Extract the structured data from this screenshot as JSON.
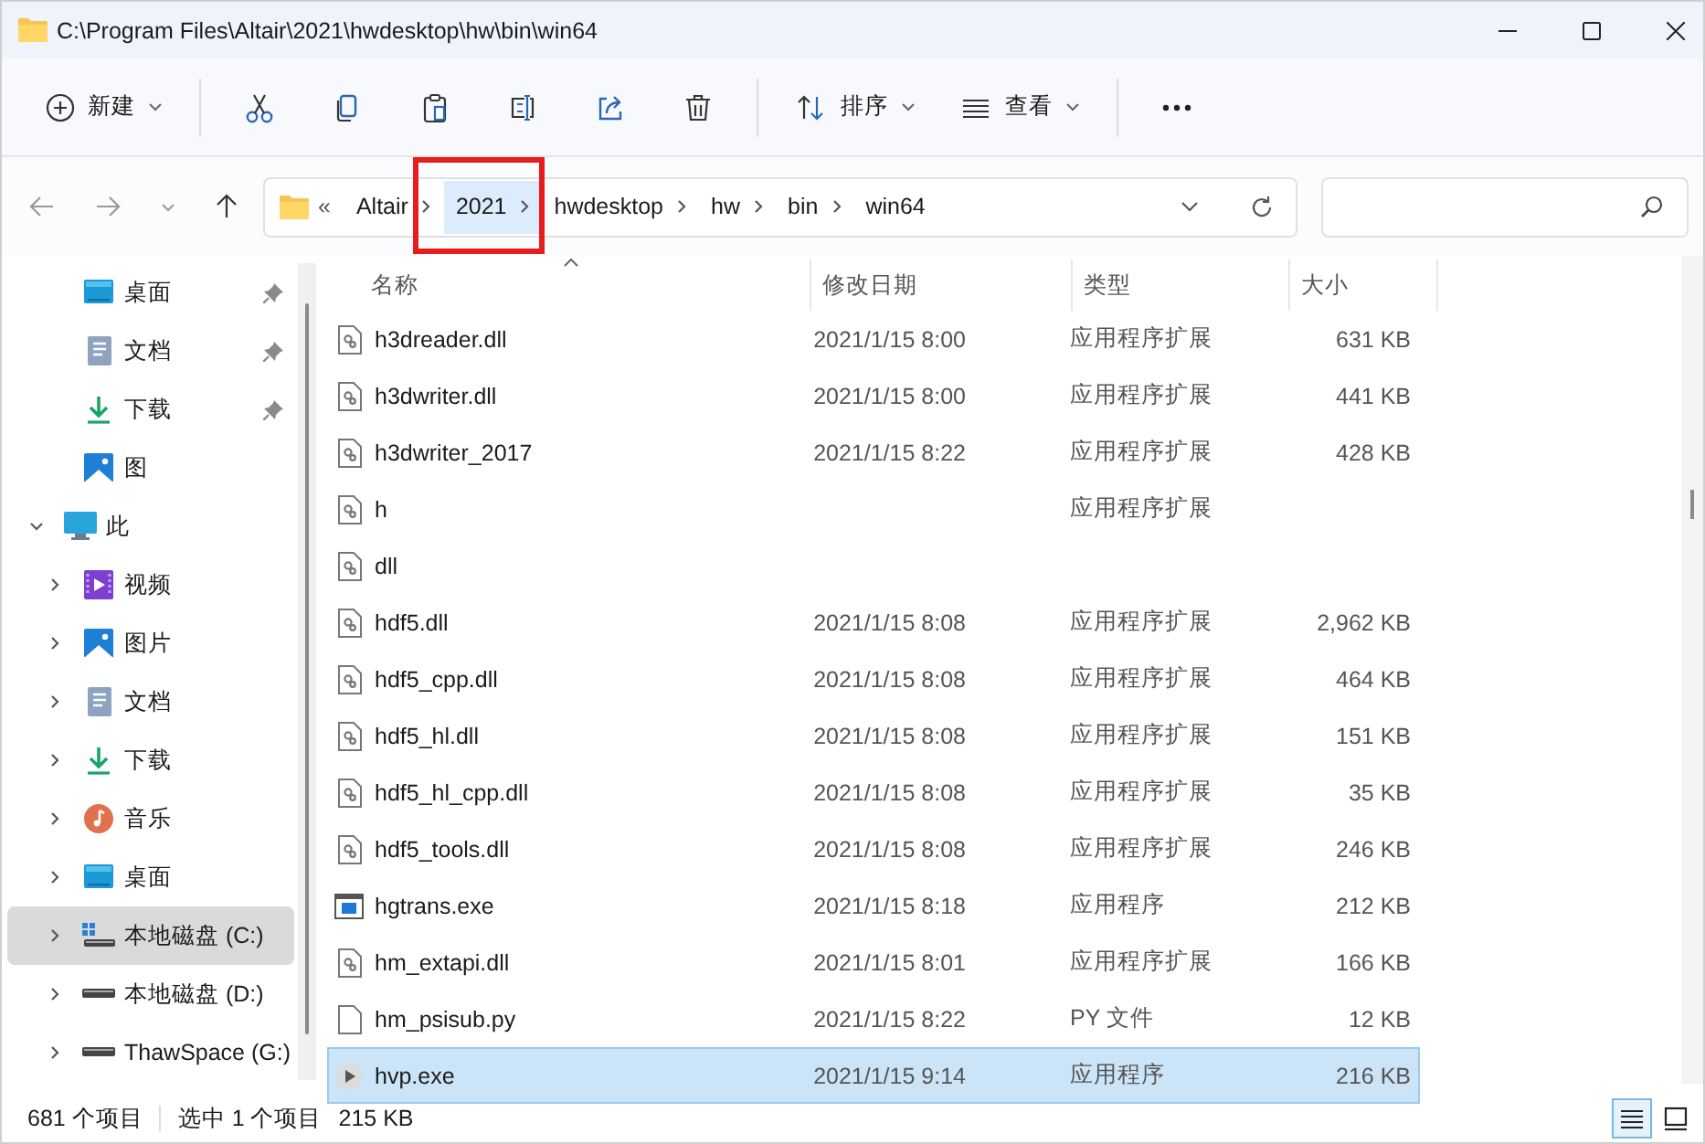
{
  "window": {
    "title": "C:\\Program Files\\Altair\\2021\\hwdesktop\\hw\\bin\\win64"
  },
  "toolbar": [
    {
      "kind": "new",
      "label": "新建",
      "caret": true
    },
    {
      "kind": "cut"
    },
    {
      "kind": "copy"
    },
    {
      "kind": "paste"
    },
    {
      "kind": "rename"
    },
    {
      "kind": "share"
    },
    {
      "kind": "delete"
    },
    {
      "kind": "sort",
      "label": "排序",
      "caret": true
    },
    {
      "kind": "view",
      "label": "查看",
      "caret": true
    },
    {
      "kind": "more"
    }
  ],
  "address": {
    "overflow": "«",
    "segments": [
      {
        "label": "Altair",
        "highlighted": false
      },
      {
        "label": "2021",
        "highlighted": true
      },
      {
        "label": "hwdesktop",
        "highlighted": false
      },
      {
        "label": "hw",
        "highlighted": false
      },
      {
        "label": "bin",
        "highlighted": false
      },
      {
        "label": "win64",
        "highlighted": false
      }
    ]
  },
  "sidebar": {
    "items": [
      {
        "label": "桌面",
        "kind": "desktop",
        "pinned": true,
        "selected": false
      },
      {
        "label": "文档",
        "kind": "document",
        "pinned": true,
        "selected": false
      },
      {
        "label": "下载",
        "kind": "download",
        "pinned": true,
        "selected": false
      },
      {
        "label": "图",
        "kind": "picture",
        "pinned": false,
        "selected": false
      },
      {
        "label": "此",
        "kind": "monitor",
        "expanded": true,
        "selected": false,
        "children": [
          {
            "label": "视频",
            "kind": "video",
            "expanded": false,
            "selected": false
          },
          {
            "label": "图片",
            "kind": "picture",
            "expanded": false,
            "selected": false
          },
          {
            "label": "文档",
            "kind": "document",
            "expanded": false,
            "selected": false
          },
          {
            "label": "下载",
            "kind": "download",
            "expanded": false,
            "selected": false
          },
          {
            "label": "音乐",
            "kind": "music",
            "expanded": false,
            "selected": false
          },
          {
            "label": "桌面",
            "kind": "desktop",
            "expanded": false,
            "selected": false
          },
          {
            "label": "本地磁盘 (C:)",
            "kind": "system-drive",
            "expanded": false,
            "selected": true
          },
          {
            "label": "本地磁盘 (D:)",
            "kind": "drive",
            "expanded": false,
            "selected": false
          },
          {
            "label": "ThawSpace (G:)",
            "kind": "drive",
            "expanded": false,
            "selected": false
          }
        ]
      }
    ]
  },
  "table": {
    "columns": [
      {
        "label": "名称",
        "sorted": true
      },
      {
        "label": "修改日期",
        "sorted": false
      },
      {
        "label": "类型",
        "sorted": false
      },
      {
        "label": "大小",
        "sorted": false
      }
    ],
    "rows": [
      {
        "kind": "dll",
        "name": "h3dreader.dll",
        "date": "2021/1/15 8:00",
        "type": "应用程序扩展",
        "size": "631 KB",
        "selected": false
      },
      {
        "kind": "dll",
        "name": "h3dwriter.dll",
        "date": "2021/1/15 8:00",
        "type": "应用程序扩展",
        "size": "441 KB",
        "selected": false
      },
      {
        "kind": "dll",
        "name": "h3dwriter_2017",
        "date": "2021/1/15 8:22",
        "type": "应用程序扩展",
        "size": "428 KB",
        "selected": false
      },
      {
        "kind": "dll",
        "name": "h",
        "type": "应用程序扩展",
        "selected": false
      },
      {
        "kind": "dll",
        "name": "dll",
        "selected": false
      },
      {
        "kind": "dll",
        "name": "hdf5.dll",
        "date": "2021/1/15 8:08",
        "type": "应用程序扩展",
        "size": "2,962 KB",
        "selected": false
      },
      {
        "kind": "dll",
        "name": "hdf5_cpp.dll",
        "date": "2021/1/15 8:08",
        "type": "应用程序扩展",
        "size": "464 KB",
        "selected": false
      },
      {
        "kind": "dll",
        "name": "hdf5_hl.dll",
        "date": "2021/1/15 8:08",
        "type": "应用程序扩展",
        "size": "151 KB",
        "selected": false
      },
      {
        "kind": "dll",
        "name": "hdf5_hl_cpp.dll",
        "date": "2021/1/15 8:08",
        "type": "应用程序扩展",
        "size": "35 KB",
        "selected": false
      },
      {
        "kind": "dll",
        "name": "hdf5_tools.dll",
        "date": "2021/1/15 8:08",
        "type": "应用程序扩展",
        "size": "246 KB",
        "selected": false
      },
      {
        "kind": "app",
        "name": "hgtrans.exe",
        "date": "2021/1/15 8:18",
        "type": "应用程序",
        "size": "212 KB",
        "selected": false
      },
      {
        "kind": "dll",
        "name": "hm_extapi.dll",
        "date": "2021/1/15 8:01",
        "type": "应用程序扩展",
        "size": "166 KB",
        "selected": false
      },
      {
        "kind": "blank",
        "name": "hm_psisub.py",
        "date": "2021/1/15 8:22",
        "type": "PY 文件",
        "size": "12 KB",
        "selected": false
      },
      {
        "kind": "play",
        "name": "hvp.exe",
        "date": "2021/1/15 9:14",
        "type": "应用程序",
        "size": "216 KB",
        "selected": true
      }
    ]
  },
  "status_bar": {
    "items": [
      "681 个项目",
      "选中 1 个项目",
      "215 KB"
    ],
    "views": [
      {
        "kind": "details",
        "selected": true
      },
      {
        "kind": "tiles",
        "selected": false
      }
    ]
  }
}
